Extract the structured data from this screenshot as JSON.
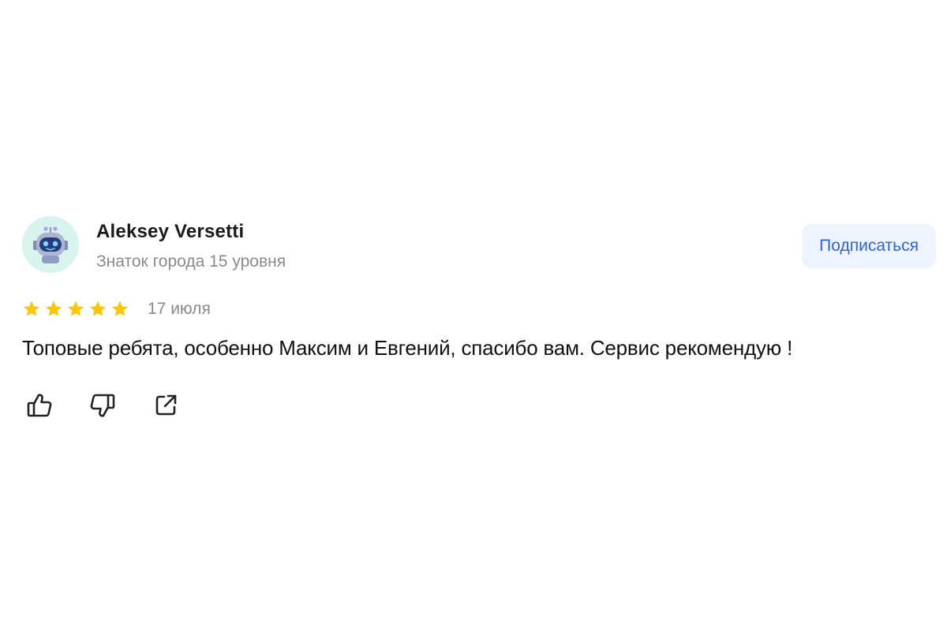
{
  "review": {
    "author": {
      "name": "Aleksey Versetti",
      "level": "Знаток города 15 уровня",
      "avatar_icon": "robot-avatar-icon"
    },
    "subscribe_label": "Подписаться",
    "rating": 5,
    "rating_max": 5,
    "date": "17 июля",
    "text": "Топовые ребята, особенно Максим и Евгений, спасибо вам. Сервис рекомендую !",
    "actions": [
      {
        "icon": "thumbs-up-icon"
      },
      {
        "icon": "thumbs-down-icon"
      },
      {
        "icon": "share-icon"
      }
    ]
  },
  "colors": {
    "star": "#fcc700",
    "subscribe_text": "#2f63e0",
    "subscribe_bg": "#eef3fd",
    "avatar_bg": "#d9f3ef",
    "muted_text": "#8a8a8a"
  }
}
